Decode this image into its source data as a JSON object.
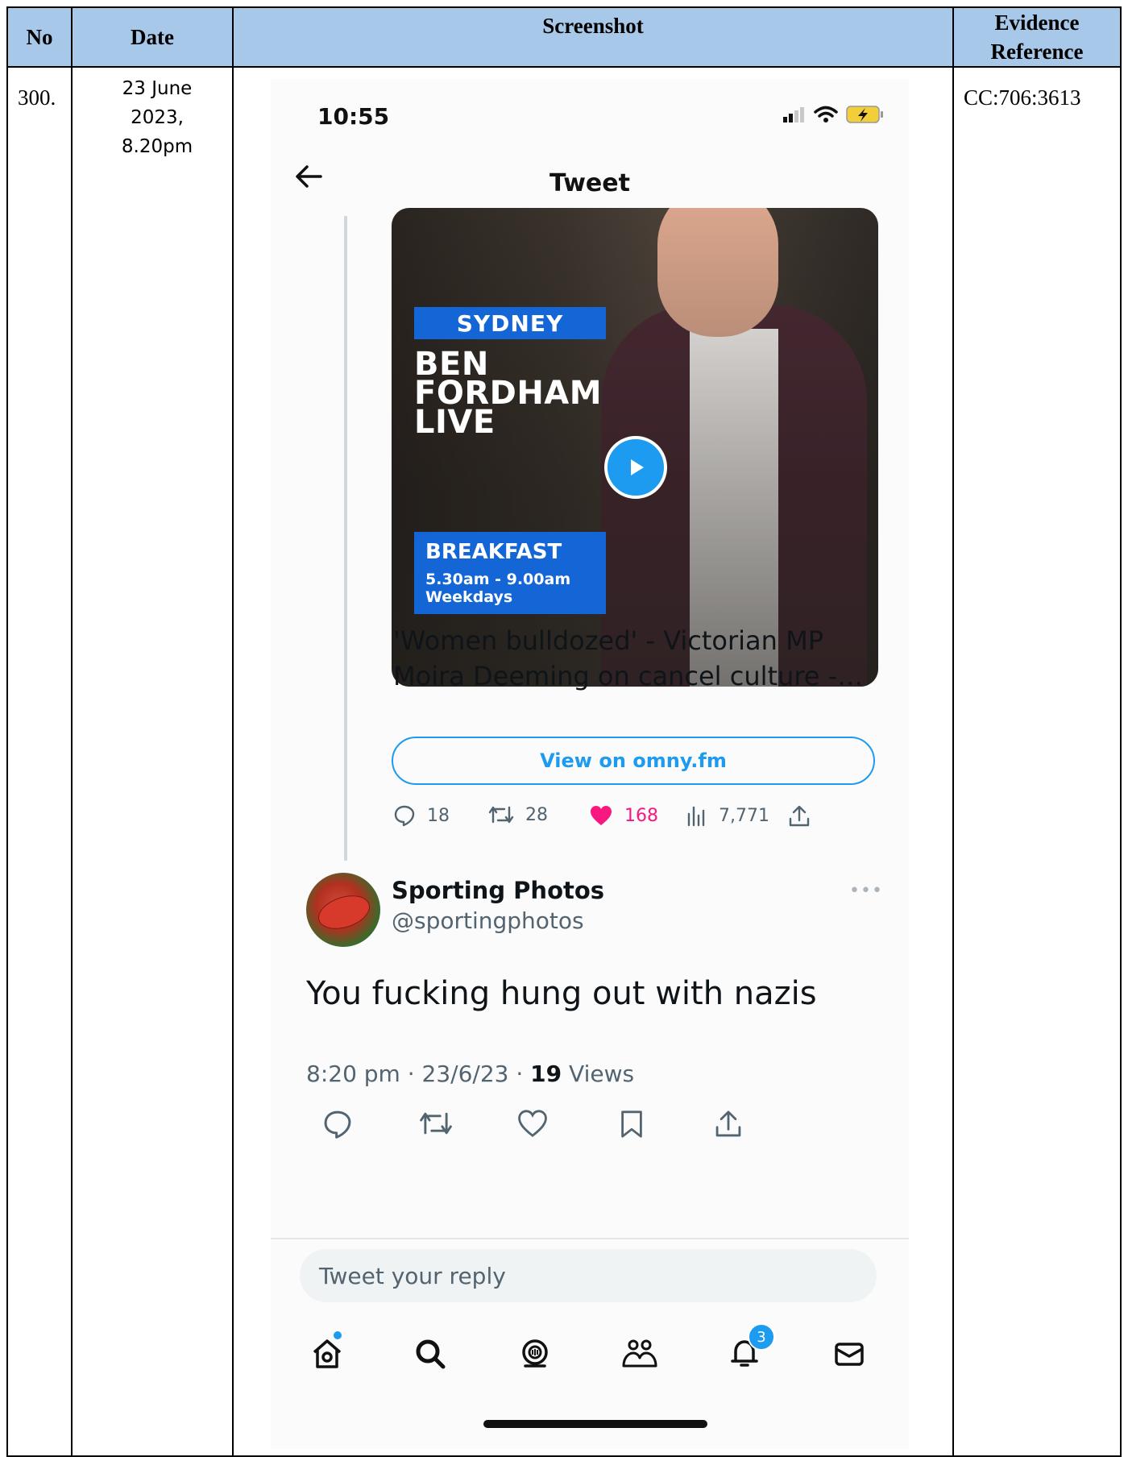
{
  "table": {
    "headers": {
      "no": "No",
      "date": "Date",
      "screenshot": "Screenshot",
      "evidence_line1": "Evidence",
      "evidence_line2": "Reference"
    },
    "row": {
      "no": "300.",
      "date_line1": "23 June",
      "date_line2": "2023,",
      "date_line3": "8.20pm",
      "evidence": "CC:706:3613"
    }
  },
  "phone": {
    "status_time": "10:55",
    "nav_title": "Tweet",
    "media": {
      "tag": "SYDNEY",
      "title_line1": "BEN",
      "title_line2": "FORDHAM",
      "title_line3": "LIVE",
      "slot_label": "BREAKFAST",
      "slot_time": "5.30am - 9.00am",
      "slot_days": "Weekdays"
    },
    "card_title_line1": "'Women bulldozed' - Victorian MP",
    "card_title_line2": "Moira Deeming on cancel culture -…",
    "view_button": "View on omny.fm",
    "parent_stats": {
      "replies": "18",
      "retweets": "28",
      "likes": "168",
      "views": "7,771"
    },
    "tweet": {
      "name": "Sporting Photos",
      "handle": "@sportingphotos",
      "text": "You fucking hung out with nazis",
      "meta_prefix": "8:20 pm · 23/6/23 · ",
      "views_count": "19",
      "views_label": " Views"
    },
    "reply_placeholder": "Tweet your reply",
    "notifications_badge": "3",
    "colors": {
      "accent": "#1d9bf0",
      "like": "#f91880",
      "header_bg": "#a7c8e8"
    }
  }
}
